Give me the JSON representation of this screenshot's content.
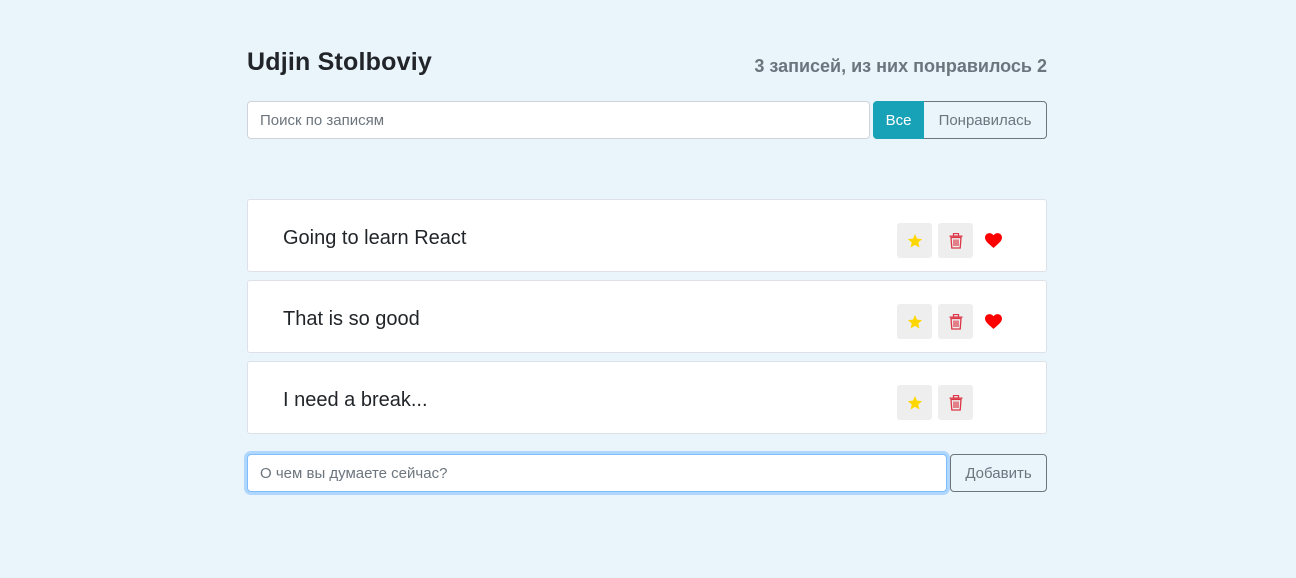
{
  "header": {
    "title": "Udjin Stolboviy",
    "stats": "3 записей, из них понравилось 2"
  },
  "search": {
    "placeholder": "Поиск по записям",
    "value": ""
  },
  "filters": {
    "all_label": "Все",
    "liked_label": "Понравилась",
    "active": "all"
  },
  "posts": [
    {
      "label": "Going to learn React",
      "liked": true,
      "important": false
    },
    {
      "label": "That is so good",
      "liked": true,
      "important": false
    },
    {
      "label": "I need a break...",
      "liked": false,
      "important": false
    }
  ],
  "add_form": {
    "placeholder": "О чем вы думаете сейчас?",
    "value": "",
    "button_label": "Добавить"
  },
  "colors": {
    "background": "#eaf4fb",
    "accent": "#17a2b8",
    "star": "#ffd700",
    "trash": "#dc3545",
    "heart": "#ff0000"
  },
  "icons": {
    "star": "star-icon",
    "trash": "trash-icon",
    "heart": "heart-icon"
  }
}
